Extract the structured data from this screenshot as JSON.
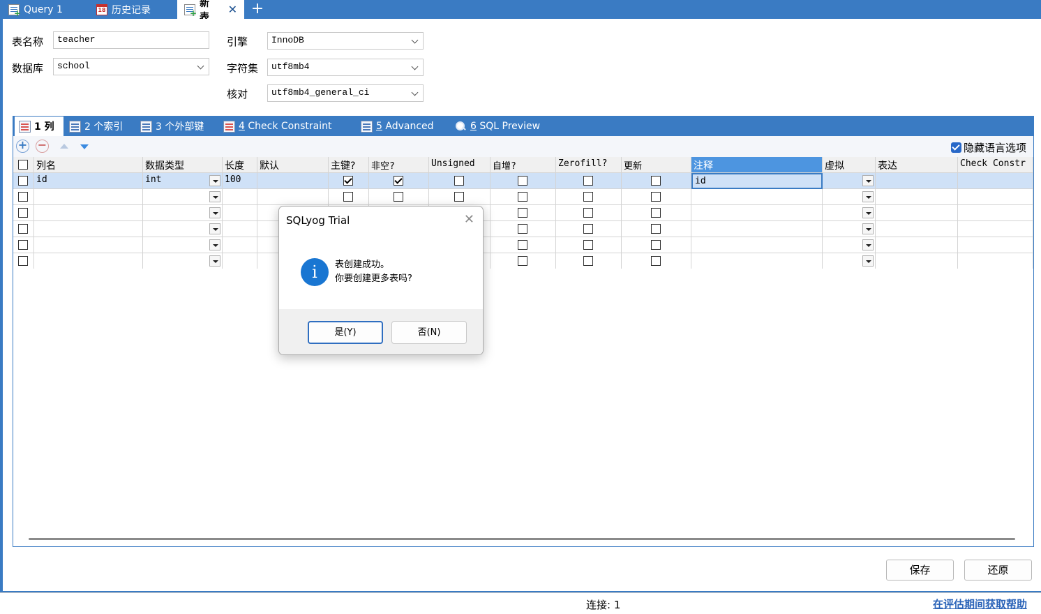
{
  "tabs": [
    {
      "label": "Query 1",
      "icon": "query-icon"
    },
    {
      "label": "历史记录",
      "icon": "calendar-icon",
      "icon_text": "18"
    },
    {
      "label": "新表",
      "icon": "new-table-icon",
      "active": true
    }
  ],
  "form": {
    "table_name_label": "表名称",
    "table_name": "teacher",
    "database_label": "数据库",
    "database": "school",
    "engine_label": "引擎",
    "engine": "InnoDB",
    "charset_label": "字符集",
    "charset": "utf8mb4",
    "collation_label": "核对",
    "collation": "utf8mb4_general_ci"
  },
  "subtabs": [
    {
      "num": "1",
      "label": " 列",
      "active": true
    },
    {
      "num": "2",
      "label": " 个索引"
    },
    {
      "num": "3",
      "label": " 个外部键"
    },
    {
      "num": "4",
      "label": " Check Constraint"
    },
    {
      "num": "5",
      "label": " Advanced"
    },
    {
      "num": "6",
      "label": " SQL Preview"
    }
  ],
  "hide_language_options": "隐藏语言选项",
  "columns_header": [
    "列名",
    "数据类型",
    "长度",
    "默认",
    "主键?",
    "非空?",
    "Unsigned",
    "自增?",
    "Zerofill?",
    "更新",
    "注释",
    "虚拟",
    "表达",
    "Check Constr"
  ],
  "rows": [
    {
      "name": "id",
      "type": "int",
      "length": "100",
      "default": "",
      "pk": true,
      "notnull": true,
      "unsigned": false,
      "autoinc": false,
      "zerofill": false,
      "update": false,
      "comment": "id"
    },
    {
      "name": "",
      "type": "",
      "length": "",
      "default": "",
      "pk": false,
      "notnull": false,
      "unsigned": false,
      "autoinc": false,
      "zerofill": false,
      "update": false,
      "comment": ""
    },
    {
      "name": "",
      "type": "",
      "length": "",
      "default": "",
      "pk": false,
      "notnull": false,
      "unsigned": false,
      "autoinc": false,
      "zerofill": false,
      "update": false,
      "comment": ""
    },
    {
      "name": "",
      "type": "",
      "length": "",
      "default": "",
      "pk": false,
      "notnull": false,
      "unsigned": false,
      "autoinc": false,
      "zerofill": false,
      "update": false,
      "comment": ""
    },
    {
      "name": "",
      "type": "",
      "length": "",
      "default": "",
      "pk": false,
      "notnull": false,
      "unsigned": false,
      "autoinc": false,
      "zerofill": false,
      "update": false,
      "comment": ""
    },
    {
      "name": "",
      "type": "",
      "length": "",
      "default": "",
      "pk": false,
      "notnull": false,
      "unsigned": false,
      "autoinc": false,
      "zerofill": false,
      "update": false,
      "comment": ""
    }
  ],
  "buttons": {
    "save": "保存",
    "revert": "还原"
  },
  "status": {
    "connection": "连接: 1",
    "help": "在评估期间获取帮助"
  },
  "dialog": {
    "title": "SQLyog Trial",
    "line1": "表创建成功。",
    "line2": "你要创建更多表吗?",
    "yes": "是(Y)",
    "no": "否(N)",
    "icon": "info-icon"
  },
  "colors": {
    "accent": "#3a7bc3",
    "selection": "#cfe1f7",
    "info": "#1976d2",
    "help_link": "#2a63b8"
  }
}
